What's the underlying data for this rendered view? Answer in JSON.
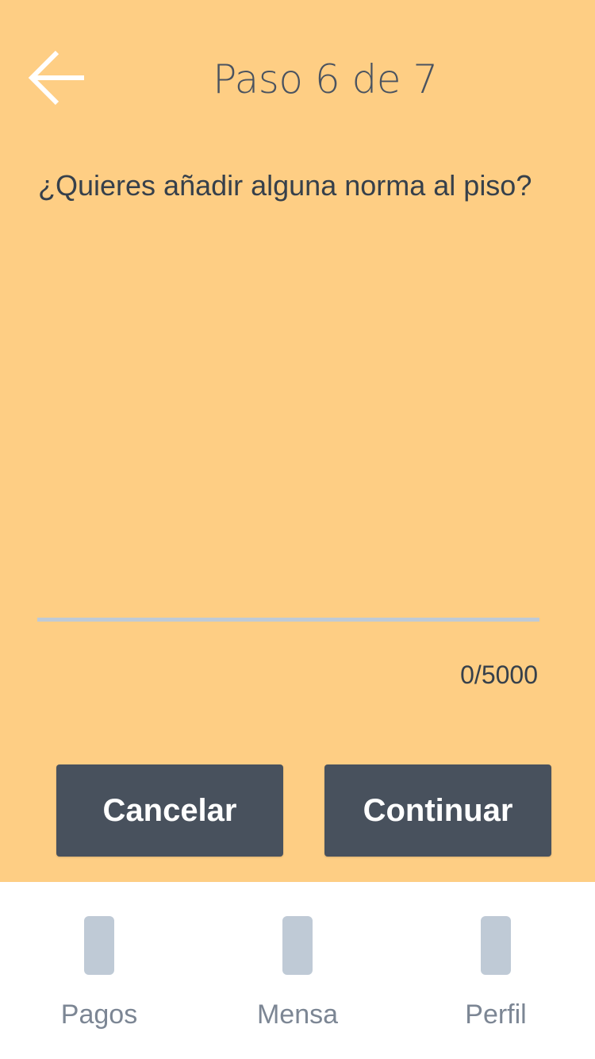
{
  "header": {
    "back_icon": "arrow-left-icon",
    "step_title": "Paso 6 de 7"
  },
  "form": {
    "question": "¿Quieres añadir alguna norma al piso?",
    "input_value": "",
    "char_counter": "0/5000"
  },
  "actions": {
    "cancel_label": "Cancelar",
    "continue_label": "Continuar"
  },
  "bottom_nav": {
    "items": [
      {
        "label": "Pagos",
        "icon": "placeholder-icon"
      },
      {
        "label": "Mensa",
        "icon": "placeholder-icon"
      },
      {
        "label": "Perfil",
        "icon": "placeholder-icon"
      }
    ]
  },
  "colors": {
    "background": "#FECE84",
    "button": "#48515D",
    "text_dark": "#36404B",
    "underline": "#BFCAD6",
    "nav_label": "#7C8694"
  }
}
